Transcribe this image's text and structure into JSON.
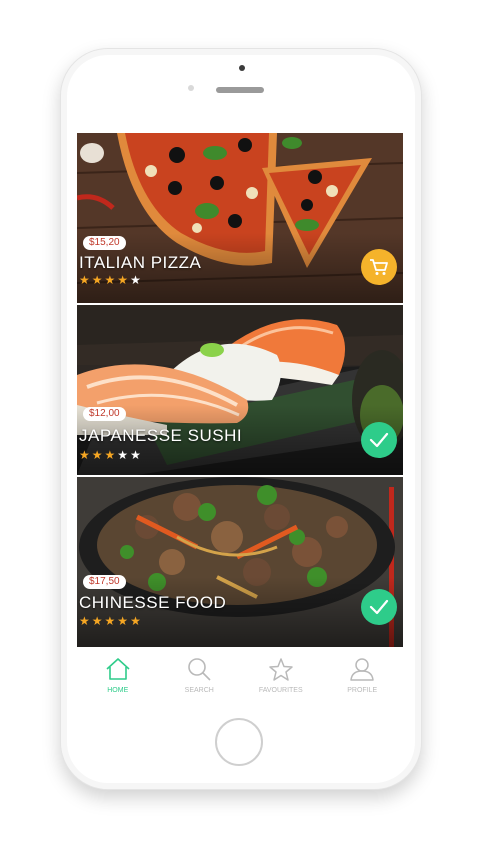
{
  "items": [
    {
      "price": "$15,20",
      "title": "ITALIAN PIZZA",
      "rating": 4,
      "max_rating": 5,
      "action": "cart-icon",
      "action_color": "#f5b32b"
    },
    {
      "price": "$12,00",
      "title": "JAPANESSE SUSHI",
      "rating": 3,
      "max_rating": 5,
      "action": "check-icon",
      "action_color": "#2ecc8a"
    },
    {
      "price": "$17,50",
      "title": "CHINESSE FOOD",
      "rating": 5,
      "max_rating": 5,
      "action": "check-icon",
      "action_color": "#2ecc8a"
    }
  ],
  "nav": {
    "items": [
      {
        "label": "HOME",
        "icon": "home-icon",
        "active": true
      },
      {
        "label": "SEARCH",
        "icon": "search-icon",
        "active": false
      },
      {
        "label": "FAVOURITES",
        "icon": "star-icon",
        "active": false
      },
      {
        "label": "PROFILE",
        "icon": "profile-icon",
        "active": false
      }
    ]
  },
  "colors": {
    "accent": "#2ecc8a",
    "cart": "#f5b32b",
    "star": "#f5a623",
    "price_text": "#c0392b"
  }
}
